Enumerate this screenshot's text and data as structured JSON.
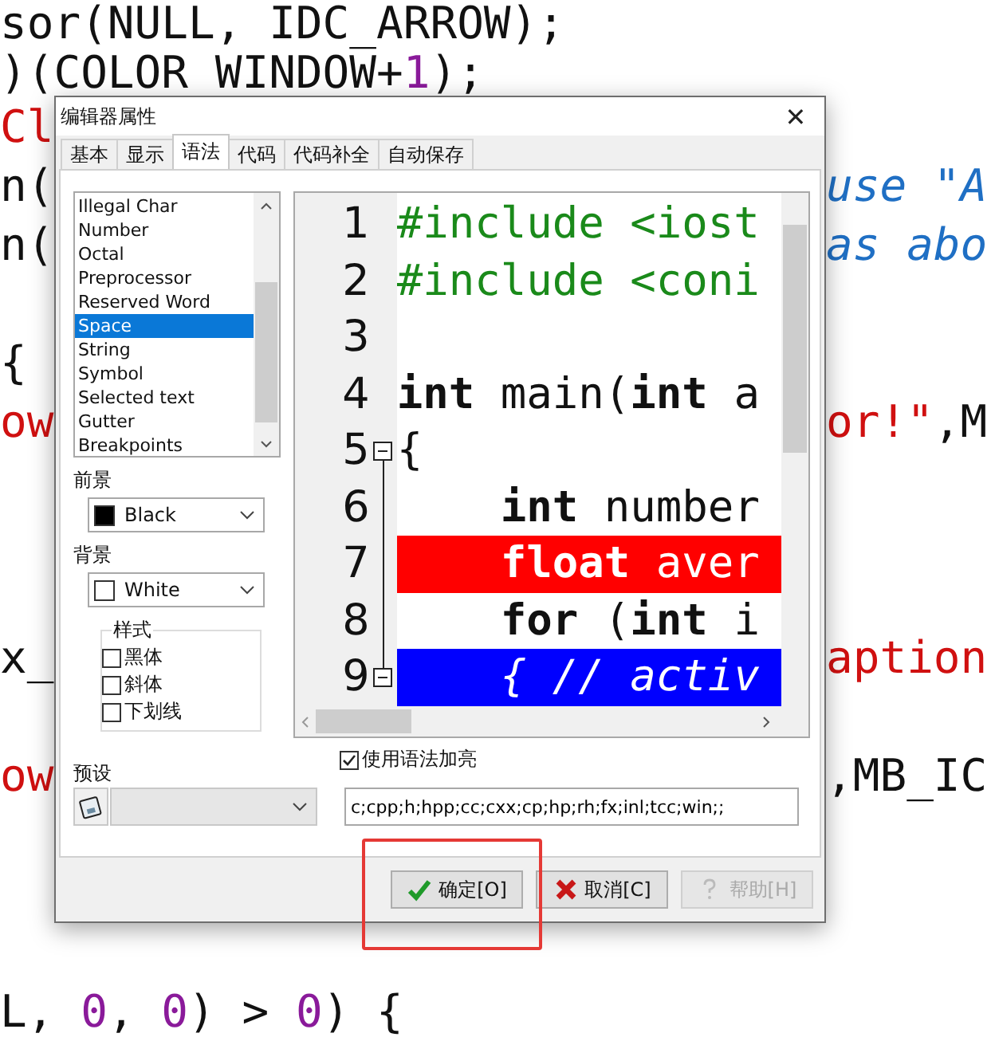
{
  "background_code": {
    "lines": [
      {
        "kind": "code",
        "left": [
          {
            "text": "sor(NULL, IDC_ARROW);",
            "kind": "plain"
          }
        ]
      },
      {
        "kind": "code",
        "left": [
          {
            "text": ")(COLOR_WINDOW+",
            "kind": "plain"
          },
          {
            "text": "1",
            "kind": "number"
          },
          {
            "text": ");",
            "kind": "plain"
          }
        ]
      },
      {
        "kind": "code",
        "left": [
          {
            "text": "Cl",
            "kind": "string"
          }
        ]
      },
      {
        "kind": "code",
        "left": [
          {
            "text": "n(",
            "kind": "plain"
          }
        ],
        "right": [
          {
            "text": "use \"A",
            "kind": "comment"
          }
        ]
      },
      {
        "kind": "code",
        "left": [
          {
            "text": "n(",
            "kind": "plain"
          }
        ],
        "right": [
          {
            "text": "as abo",
            "kind": "comment"
          }
        ]
      },
      {
        "kind": "blank"
      },
      {
        "kind": "code",
        "left": [
          {
            "text": "{",
            "kind": "plain"
          }
        ]
      },
      {
        "kind": "code",
        "left": [
          {
            "text": "ow",
            "kind": "string"
          }
        ],
        "right": [
          {
            "text": "or!\"",
            "kind": "string"
          },
          {
            "text": ",M",
            "kind": "plain"
          }
        ]
      },
      {
        "kind": "blank"
      },
      {
        "kind": "blank"
      },
      {
        "kind": "blank"
      },
      {
        "kind": "code",
        "left": [
          {
            "text": "x_",
            "kind": "plain"
          }
        ],
        "right": [
          {
            "text": "aption",
            "kind": "string"
          }
        ]
      },
      {
        "kind": "blank"
      },
      {
        "kind": "code",
        "left": [
          {
            "text": "ow",
            "kind": "string"
          }
        ],
        "right": [
          {
            "text": ",MB_IC",
            "kind": "plain"
          }
        ]
      },
      {
        "kind": "blank"
      },
      {
        "kind": "blank"
      },
      {
        "kind": "blank"
      },
      {
        "kind": "code",
        "left": [
          {
            "text": "L, ",
            "kind": "plain"
          },
          {
            "text": "0",
            "kind": "number"
          },
          {
            "text": ", ",
            "kind": "plain"
          },
          {
            "text": "0",
            "kind": "number"
          },
          {
            "text": ") > ",
            "kind": "plain"
          },
          {
            "text": "0",
            "kind": "number"
          },
          {
            "text": ") {",
            "kind": "plain"
          }
        ]
      }
    ]
  },
  "dialog": {
    "title": "编辑器属性",
    "close": "✕",
    "tabs": [
      {
        "label": "基本",
        "selected": false
      },
      {
        "label": "显示",
        "selected": false
      },
      {
        "label": "语法",
        "selected": true
      },
      {
        "label": "代码",
        "selected": false
      },
      {
        "label": "代码补全",
        "selected": false
      },
      {
        "label": "自动保存",
        "selected": false
      }
    ],
    "elements": [
      {
        "label": "Illegal Char",
        "selected": false
      },
      {
        "label": "Number",
        "selected": false
      },
      {
        "label": "Octal",
        "selected": false
      },
      {
        "label": "Preprocessor",
        "selected": false
      },
      {
        "label": "Reserved Word",
        "selected": false
      },
      {
        "label": "Space",
        "selected": true
      },
      {
        "label": "String",
        "selected": false
      },
      {
        "label": "Symbol",
        "selected": false
      },
      {
        "label": "Selected text",
        "selected": false
      },
      {
        "label": "Gutter",
        "selected": false
      },
      {
        "label": "Breakpoints",
        "selected": false
      }
    ],
    "colors": [
      {
        "label": "前景",
        "value": "Black",
        "color": "#000000"
      },
      {
        "label": "背景",
        "value": "White",
        "color": "#ffffff"
      }
    ],
    "style_group": {
      "title": "样式",
      "options": [
        {
          "label": "黑体",
          "checked": false
        },
        {
          "label": "斜体",
          "checked": false
        },
        {
          "label": "下划线",
          "checked": false
        }
      ]
    },
    "preview": [
      {
        "number": "1",
        "text": "#include <iost",
        "kind": "directive",
        "fold": false
      },
      {
        "number": "2",
        "text": "#include <coni",
        "kind": "directive",
        "fold": false
      },
      {
        "number": "3",
        "kind": "normal",
        "fold": false
      },
      {
        "number": "4",
        "text": "**int** main(**int** a",
        "kind": "normal",
        "fold": false
      },
      {
        "number": "5",
        "text": "{",
        "kind": "normal",
        "fold": true
      },
      {
        "number": "6",
        "text": "    **int** number",
        "kind": "normal",
        "fold": false
      },
      {
        "number": "7",
        "text": "    **float** aver",
        "kind": "error",
        "fold": false
      },
      {
        "number": "8",
        "text": "    **for** (**int** i",
        "kind": "normal",
        "fold": false
      },
      {
        "number": "9",
        "text": "    { // activ",
        "kind": "active",
        "fold": true
      }
    ],
    "syntax_highlight": {
      "label": "使用语法加亮",
      "checked": true
    },
    "preset": {
      "label": "预设"
    },
    "extensions": {
      "value": "c;cpp;h;hpp;cc;cxx;cp;hp;rh;fx;inl;tcc;win;;"
    },
    "buttons": [
      {
        "label": "确定[O]",
        "kind": "ok",
        "disabled": false
      },
      {
        "label": "取消[C]",
        "kind": "cancel",
        "disabled": false
      },
      {
        "label": "帮助[H]",
        "kind": "help",
        "disabled": true
      }
    ]
  }
}
